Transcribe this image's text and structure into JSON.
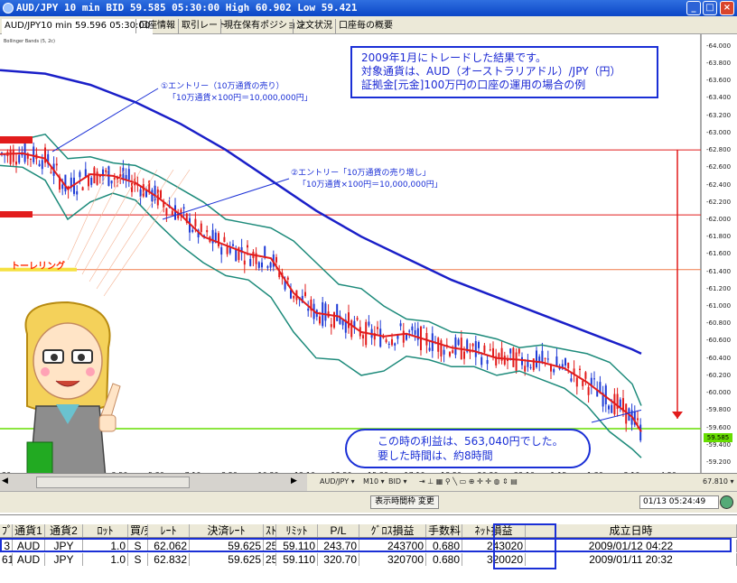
{
  "window": {
    "title": "AUD/JPY 10 min BID 59.585 05:30:00 High 60.902 Low 59.421"
  },
  "tabs": [
    {
      "label": "AUD/JPY10 min 59.596 05:30:00"
    },
    {
      "label": "口座情報"
    },
    {
      "label": "取引レート"
    },
    {
      "label": "現在保有ポジション"
    },
    {
      "label": "注文状況"
    },
    {
      "label": "口座毎の概要"
    }
  ],
  "chart": {
    "indicator_label": "Bollinger Bands (5, 2c)",
    "info_lines": [
      "2009年1月にトレードした結果です。",
      "対象通貨は、AUD（オーストラリアドル）/JPY（円）",
      "証拠金[元金]100万円の口座の運用の場合の例"
    ],
    "entry1": {
      "line1": "①エントリー（10万通貨の売り）",
      "line2": "「10万通貨×100円＝10,000,000円」"
    },
    "entry2": {
      "line1": "②エントリー「10万通貨の売り増し」",
      "line2": "「10万通貨×100円＝10,000,000円」"
    },
    "trailing_label": "トーレリング",
    "profit_lines": [
      "この時の利益は、563,040円でした。",
      "要した時間は、約8時間"
    ],
    "current_price": "59.585",
    "colors": {
      "price_up": "#1f3bd6",
      "price_down": "#e21c1c",
      "ma": "#e21c1c",
      "bands": "#1c8a7a",
      "long_ma": "#1a1fc8",
      "current": "#66dd00",
      "annotation": "#1a2fd6"
    }
  },
  "chart_data": {
    "type": "line",
    "title": "",
    "ylim": [
      59.2,
      64.05
    ],
    "y_ticks": [
      "64.000",
      "63.800",
      "63.600",
      "63.400",
      "63.200",
      "63.000",
      "62.800",
      "62.600",
      "62.400",
      "62.200",
      "62.000",
      "61.800",
      "61.600",
      "61.400",
      "61.200",
      "61.000",
      "60.800",
      "60.600",
      "60.400",
      "60.200",
      "60.000",
      "59.800",
      "59.600",
      "59.400",
      "59.200"
    ],
    "x_ticks": [
      "30",
      "1:12",
      "2:10",
      "3:50",
      "5:30",
      "7:10",
      "8:50",
      "10:30",
      "12:10",
      "13:50",
      "15:30",
      "17:10",
      "18:50",
      "20:30",
      "22:10",
      "1:15",
      "1:30",
      "3:10",
      "4:50"
    ],
    "series": [
      {
        "x": [
          0,
          25,
          50,
          75,
          100,
          125,
          150,
          175,
          200,
          225,
          250,
          275,
          300,
          325,
          350,
          375,
          400,
          425,
          450,
          475,
          500,
          525,
          550,
          575,
          600,
          625,
          650,
          675,
          700,
          710
        ],
        "values": [
          62.75,
          62.76,
          62.7,
          62.35,
          62.52,
          62.5,
          62.42,
          62.25,
          62.05,
          61.8,
          61.7,
          61.6,
          61.55,
          61.15,
          60.92,
          60.88,
          60.7,
          60.65,
          60.68,
          60.6,
          60.52,
          60.48,
          60.4,
          60.38,
          60.35,
          60.28,
          60.12,
          59.92,
          59.72,
          59.55
        ]
      },
      {
        "x": [
          0,
          25,
          50,
          75,
          100,
          125,
          150,
          175,
          200,
          225,
          250,
          275,
          300,
          325,
          350,
          375,
          400,
          425,
          450,
          475,
          500,
          525,
          550,
          575,
          600,
          625,
          650,
          675,
          700,
          710
        ],
        "values": [
          62.9,
          62.92,
          62.98,
          62.7,
          62.72,
          62.65,
          62.62,
          62.5,
          62.35,
          62.2,
          62.0,
          61.95,
          61.9,
          61.75,
          61.5,
          61.25,
          61.2,
          61.0,
          60.85,
          60.82,
          60.7,
          60.68,
          60.62,
          60.52,
          60.55,
          60.5,
          60.45,
          60.35,
          60.1,
          59.85
        ]
      },
      {
        "x": [
          0,
          25,
          50,
          75,
          100,
          125,
          150,
          175,
          200,
          225,
          250,
          275,
          300,
          325,
          350,
          375,
          400,
          425,
          450,
          475,
          500,
          525,
          550,
          575,
          600,
          625,
          650,
          675,
          700,
          710
        ],
        "values": [
          62.62,
          62.6,
          62.45,
          62.0,
          62.2,
          62.3,
          62.22,
          61.95,
          61.7,
          61.5,
          61.35,
          61.3,
          61.1,
          60.7,
          60.4,
          60.38,
          60.2,
          60.25,
          60.42,
          60.38,
          60.3,
          60.3,
          60.2,
          60.25,
          60.15,
          60.05,
          59.85,
          59.55,
          59.35,
          59.25
        ]
      },
      {
        "x": [
          0,
          50,
          100,
          150,
          200,
          250,
          300,
          350,
          400,
          450,
          500,
          550,
          600,
          650,
          700,
          710
        ],
        "values": [
          63.72,
          63.68,
          63.55,
          63.35,
          63.1,
          62.8,
          62.45,
          62.1,
          61.8,
          61.55,
          61.3,
          61.1,
          60.9,
          60.7,
          60.5,
          60.45
        ]
      }
    ]
  },
  "toolbar": {
    "symbol": "AUD/JPY ▾",
    "timeframe": "M10 ▾",
    "side": "BID ▾",
    "zoom": "67.810 ▾"
  },
  "status": {
    "button": "表示時間枠 変更",
    "time": "01/13 05:24:49"
  },
  "table": {
    "headers": [
      "ﾌﾟﾙ",
      "通貨1",
      "通貨2",
      "ﾛｯﾄ",
      "買/売",
      "ﾚｰﾄ",
      "決済ﾚｰﾄ",
      "ｽﾄｯﾌﾟ",
      "ﾘﾐｯﾄ",
      "P/L",
      "ｸﾞﾛｽ損益",
      "手数料",
      "ﾈｯﾄ損益",
      "成立日時"
    ],
    "rows": [
      [
        "3",
        "AUD",
        "JPY",
        "1.0",
        "S",
        "62.062",
        "59.625",
        "25",
        "59.110",
        "243.70",
        "243700",
        "0.680",
        "243020",
        "2009/01/12 04:22"
      ],
      [
        "61",
        "AUD",
        "JPY",
        "1.0",
        "S",
        "62.832",
        "59.625",
        "25",
        "59.110",
        "320.70",
        "320700",
        "0.680",
        "320020",
        "2009/01/11 20:32"
      ]
    ]
  }
}
